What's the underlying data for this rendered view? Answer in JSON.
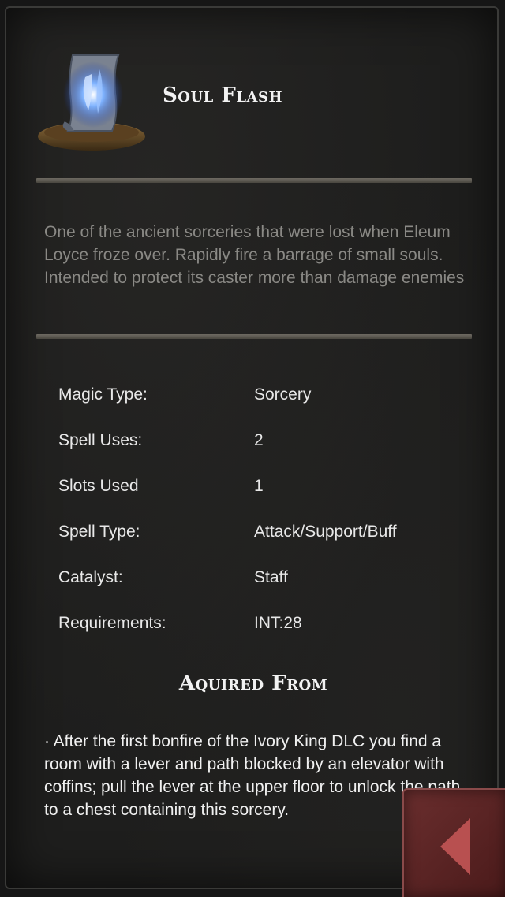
{
  "spell": {
    "title": "Soul Flash",
    "icon": "soul-flash-scroll-icon",
    "description": "One of the ancient sorceries that were lost when Eleum Loyce froze over. Rapidly fire a barrage of small souls. Intended to protect its caster more than damage enemies"
  },
  "stats": [
    {
      "label": "Magic Type:",
      "value": "Sorcery"
    },
    {
      "label": "Spell Uses:",
      "value": "2"
    },
    {
      "label": "Slots Used",
      "value": "1"
    },
    {
      "label": "Spell Type:",
      "value": "Attack/Support/Buff"
    },
    {
      "label": "Catalyst:",
      "value": "Staff"
    },
    {
      "label": "Requirements:",
      "value": "INT:28"
    }
  ],
  "acquired": {
    "heading": "Aquired From",
    "text": "· After the first bonfire of the Ivory King DLC you find a room with a lever and path blocked by an elevator with coffins; pull the lever at the upper floor to unlock the path to a chest containing this sorcery."
  },
  "back_button": {
    "icon": "back-arrow-icon"
  },
  "colors": {
    "background": "#1e1e1d",
    "divider": "#5e5a52",
    "description_text": "#8a8985",
    "back_button": "#6a2e2e",
    "arrow": "#b85050"
  }
}
